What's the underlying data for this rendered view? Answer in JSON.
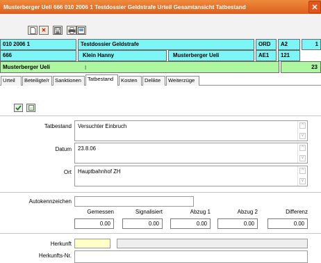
{
  "window": {
    "title": "Musterberger Ueli   666 010 2006 1 Testdossier Geldstrafe   Urteil Gesamtansicht   Tatbestand",
    "close_glyph": "✕"
  },
  "toolbar": {
    "icons": [
      "new-icon",
      "delete-icon",
      "save-icon",
      "print-icon",
      "preview-icon"
    ],
    "delete_glyph": "✕"
  },
  "header": {
    "row1": {
      "case_number": "010 2006 1",
      "case_title": "Testdossier Geldstrafe",
      "code": "ORD",
      "section": "A2",
      "number": "1"
    },
    "row2": {
      "id": "666",
      "judge": "Klein Hanny",
      "party": "Musterberger Ueli",
      "role": "AE1",
      "num": "121"
    },
    "row3": {
      "person": "Musterberger Ueli",
      "count": "23"
    }
  },
  "tabs": [
    {
      "label": "Urteil"
    },
    {
      "label": "Beteiligte/r"
    },
    {
      "label": "Sanktionen"
    },
    {
      "label": "Tatbestand",
      "active": true
    },
    {
      "label": "Kosten"
    },
    {
      "label": "Delikte"
    },
    {
      "label": "Weiterzüge"
    }
  ],
  "form": {
    "tatbestand_label": "Tatbestand",
    "tatbestand_value": "Versuchter Einbruch",
    "datum_label": "Datum",
    "datum_value": "23.8.06",
    "ort_label": "Ort",
    "ort_value": "Hauptbahnhof ZH",
    "autokennzeichen_label": "Autokennzeichen",
    "autokennzeichen_value": "",
    "speed_headers": [
      "Gemessen",
      "Signalisiert",
      "Abzug 1",
      "Abzug 2",
      "Differenz"
    ],
    "speed_values": [
      "0.00",
      "0.00",
      "0.00",
      "0.00",
      "0.00"
    ],
    "herkunft_label": "Herkunft",
    "herkunft_value": "",
    "herkunfts_nr_label": "Herkunfts-Nr."
  },
  "colors": {
    "title_bar": "#e2711f",
    "header_cells": "#7bf5f5",
    "person_row": "#aef7a1",
    "herkunft_field": "#ffffc8"
  }
}
